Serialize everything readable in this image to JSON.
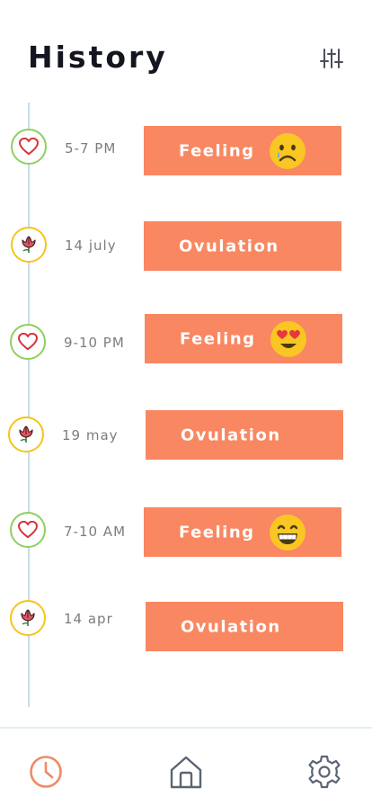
{
  "header": {
    "title": "History",
    "filter_icon": "sliders-icon"
  },
  "entries": [
    {
      "type": "feeling",
      "icon": "heart-icon",
      "time": "5-7 PM",
      "label": "Feeling",
      "emoji": "sad-tear-emoji"
    },
    {
      "type": "ovulation",
      "icon": "flower-icon",
      "time": "14 july",
      "label": "Ovulation"
    },
    {
      "type": "feeling",
      "icon": "heart-icon",
      "time": "9-10 PM",
      "label": "Feeling",
      "emoji": "heart-eyes-emoji"
    },
    {
      "type": "ovulation",
      "icon": "flower-icon",
      "time": "19 may",
      "label": "Ovulation"
    },
    {
      "type": "feeling",
      "icon": "heart-icon",
      "time": "7-10 AM",
      "label": "Feeling",
      "emoji": "grin-emoji"
    },
    {
      "type": "ovulation",
      "icon": "flower-icon",
      "time": "14 apr",
      "label": "Ovulation"
    }
  ],
  "bottom_nav": {
    "items": [
      {
        "icon": "clock-icon",
        "active": true
      },
      {
        "icon": "home-icon",
        "active": false
      },
      {
        "icon": "gear-icon",
        "active": false
      }
    ]
  },
  "colors": {
    "card": "#f98761",
    "timeline": "#c7dcec",
    "heart_ring": "#8fcf5f",
    "flower_ring": "#f5c518",
    "active_nav": "#f08a65",
    "inactive_nav": "#5b6573"
  }
}
